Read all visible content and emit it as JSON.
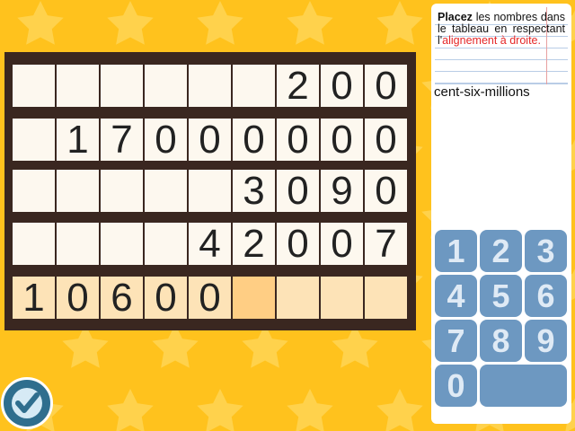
{
  "instructions": {
    "word_placez": "Placez",
    "text_middle": " les nombres dans le tableau en respectant l'",
    "highlight": "alignement à droite",
    "text_end": "."
  },
  "answer_text": "cent-six-millions",
  "grid": {
    "rows": [
      [
        "",
        "",
        "",
        "",
        "",
        "",
        "2",
        "0",
        "0"
      ],
      [
        "",
        "1",
        "7",
        "0",
        "0",
        "0",
        "0",
        "0",
        "0"
      ],
      [
        "",
        "",
        "",
        "",
        "",
        "3",
        "0",
        "9",
        "0"
      ],
      [
        "",
        "",
        "",
        "",
        "4",
        "2",
        "0",
        "0",
        "7"
      ],
      [
        "1",
        "0",
        "6",
        "0",
        "0",
        "",
        "",
        "",
        ""
      ]
    ],
    "active_row": 4,
    "cursor_col": 5
  },
  "keypad": [
    "1",
    "2",
    "3",
    "4",
    "5",
    "6",
    "7",
    "8",
    "9",
    "0",
    ""
  ],
  "validate_icon": "checkmark-icon",
  "colors": {
    "background": "#ffc21d",
    "board": "#3a2720",
    "cell": "#fdf8ef",
    "active_cell": "#fde3b7",
    "cursor_cell": "#ffce84",
    "key": "#6d98c1",
    "highlight_text": "#e52727"
  }
}
